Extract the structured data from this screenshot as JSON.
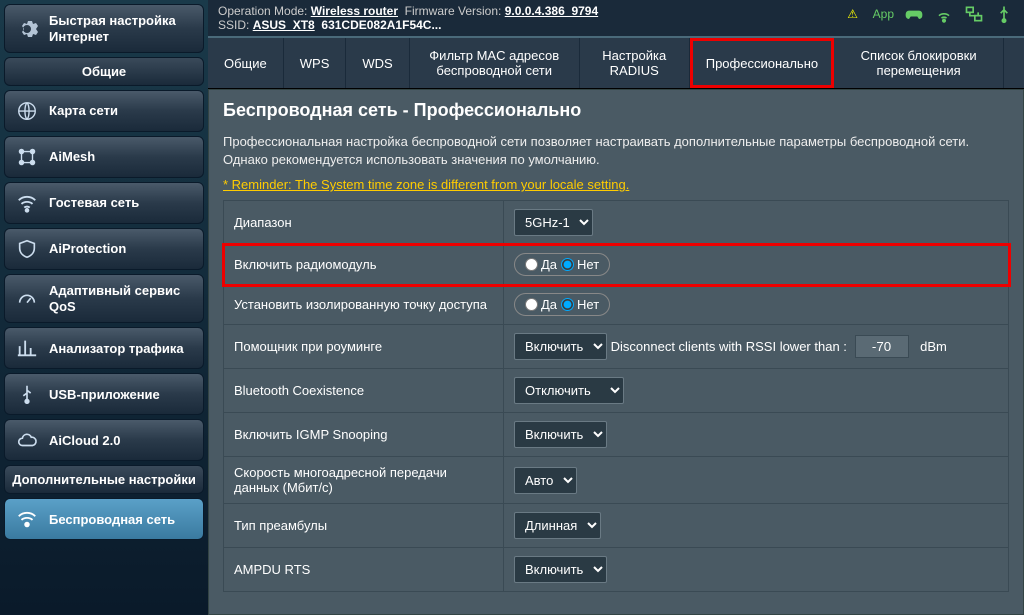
{
  "sidebar": {
    "quick_setup": "Быстрая настройка Интернет",
    "section_general": "Общие",
    "items_general": [
      "Карта сети",
      "AiMesh",
      "Гостевая сеть",
      "AiProtection",
      "Адаптивный сервис QoS",
      "Анализатор трафика",
      "USB-приложение",
      "AiCloud 2.0"
    ],
    "section_adv": "Дополнительные настройки",
    "items_adv": [
      "Беспроводная сеть"
    ]
  },
  "topbar": {
    "op_mode_label": "Operation Mode:",
    "op_mode_value": "Wireless router",
    "fw_label": "Firmware Version:",
    "fw_value": "9.0.0.4.386_9794",
    "ssid_label": "SSID:",
    "ssid1": "ASUS_XT8",
    "ssid2": "631CDE082A1F54C...",
    "app_label": "App"
  },
  "tabs": [
    "Общие",
    "WPS",
    "WDS",
    "Фильтр MAC адресов беспроводной сети",
    "Настройка RADIUS",
    "Профессионально",
    "Список блокировки перемещения"
  ],
  "page": {
    "title": "Беспроводная сеть - Профессионально",
    "desc": "Профессиональная настройка беспроводной сети позволяет настраивать дополнительные параметры беспроводной сети. Однако рекомендуется использовать значения по умолчанию.",
    "reminder": "* Reminder: The System time zone is different from your locale setting."
  },
  "labels": {
    "yes": "Да",
    "no": "Нет",
    "disconnect_note": "Disconnect clients with RSSI lower than :",
    "dbm": "dBm"
  },
  "rows": {
    "band_label": "Диапазон",
    "band_value": "5GHz-1",
    "radio_label": "Включить радиомодуль",
    "ap_iso_label": "Установить изолированную точку доступа",
    "roaming_label": "Помощник при роуминге",
    "roaming_value": "Включить",
    "rssi_value": "-70",
    "bt_label": "Bluetooth Coexistence",
    "bt_value": "Отключить",
    "igmp_label": "Включить IGMP Snooping",
    "igmp_value": "Включить",
    "mcast_label": "Скорость многоадресной передачи данных (Мбит/с)",
    "mcast_value": "Авто",
    "preamble_label": "Тип преамбулы",
    "preamble_value": "Длинная",
    "ampdu_label": "AMPDU RTS",
    "ampdu_value": "Включить"
  }
}
